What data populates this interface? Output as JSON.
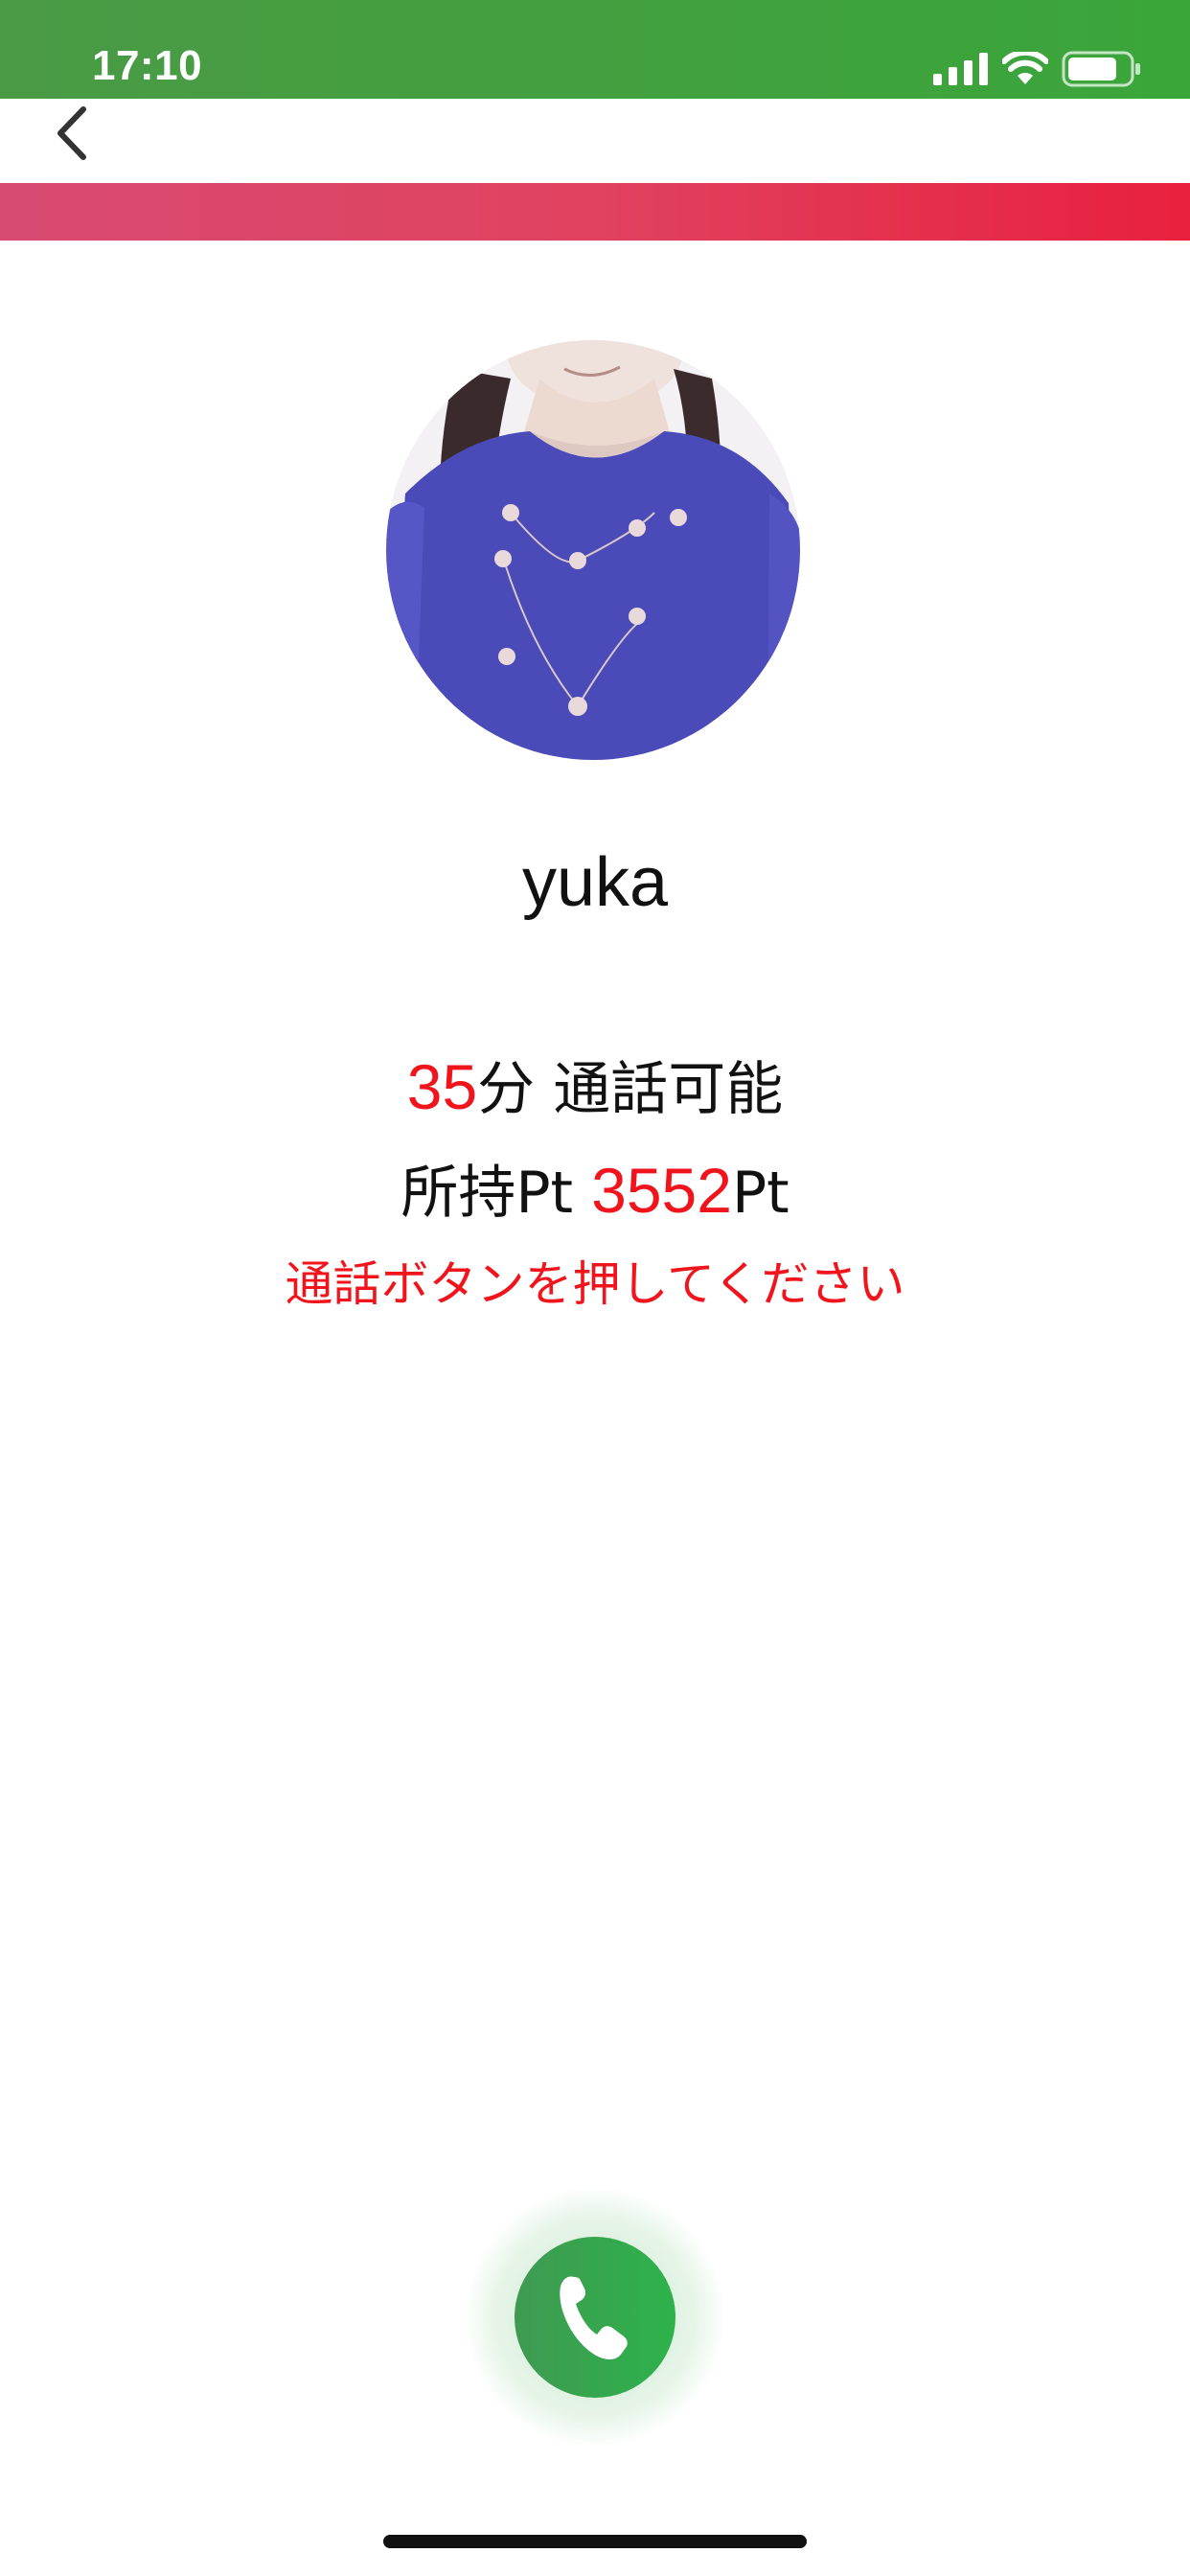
{
  "status_bar": {
    "time": "17:10",
    "icons": [
      "signal-icon",
      "wifi-icon",
      "battery-icon"
    ],
    "background": "#42a03f"
  },
  "nav": {
    "back_icon": "chevron-left-icon",
    "accent_stripe_color": "#e0405f"
  },
  "profile": {
    "username": "yuka",
    "avatar": "profile-photo"
  },
  "call_info": {
    "minutes_value": "35",
    "minutes_unit": "分",
    "minutes_label": "通話可能",
    "points_prefix": "所持Pt",
    "points_value": "3552",
    "points_suffix": "Pt",
    "instruction": "通話ボタンを押してください"
  },
  "call_button": {
    "icon": "phone-icon",
    "color": "#2fae49"
  },
  "colors": {
    "highlight_red": "#f0141c",
    "text": "#111111"
  }
}
